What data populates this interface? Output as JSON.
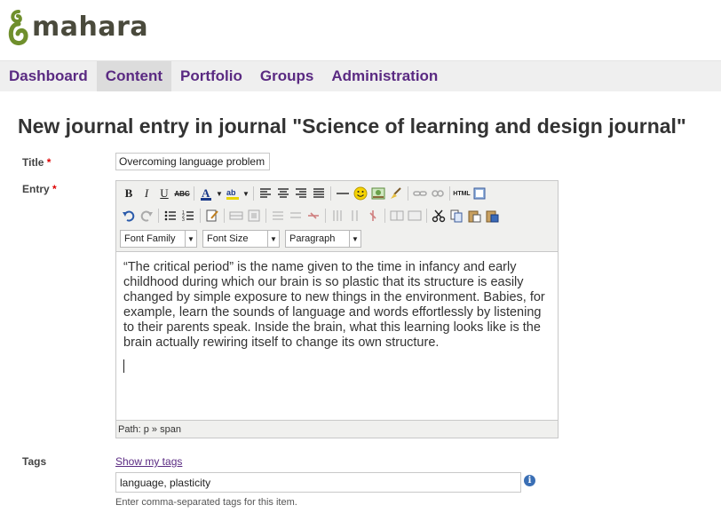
{
  "logo": {
    "text": "mahara"
  },
  "nav": {
    "items": [
      {
        "label": "Dashboard",
        "active": false
      },
      {
        "label": "Content",
        "active": true
      },
      {
        "label": "Portfolio",
        "active": false
      },
      {
        "label": "Groups",
        "active": false
      },
      {
        "label": "Administration",
        "active": false
      }
    ]
  },
  "page": {
    "heading": "New journal entry in journal \"Science of learning and design journal\""
  },
  "form": {
    "title_label": "Title",
    "required_mark": "*",
    "title_value": "Overcoming language problem",
    "entry_label": "Entry",
    "editor": {
      "font_family": "Font Family",
      "font_size": "Font Size",
      "format": "Paragraph",
      "content": "“The critical period” is the name given to the time in infancy and early childhood during which our brain is so plastic that its structure is easily changed by simple exposure to new things in the environment. Babies, for example, learn the sounds of language and words effortlessly by listening to their parents speak. Inside the brain, what this learning looks like is the brain actually rewiring itself to change its own structure.",
      "path": "Path: p » span",
      "icons": {
        "bold": "B",
        "italic": "I",
        "underline": "U",
        "strike": "ABC",
        "html": "HTML"
      }
    },
    "tags_label": "Tags",
    "show_tags": "Show my tags",
    "tags_value": "language, plasticity",
    "tags_help": "Enter comma-separated tags for this item.",
    "info_glyph": "i"
  },
  "colors": {
    "nav_text": "#5a2a82",
    "logo_green": "#6a8a2a",
    "required": "#dd0000"
  }
}
